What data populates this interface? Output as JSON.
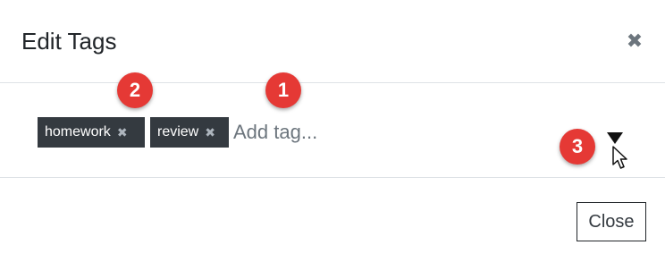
{
  "modal": {
    "title": "Edit Tags",
    "close_icon_glyph": "✖"
  },
  "tags": [
    {
      "label": "homework",
      "remove_glyph": "✖"
    },
    {
      "label": "review",
      "remove_glyph": "✖"
    }
  ],
  "tag_input": {
    "placeholder": "Add tag...",
    "value": ""
  },
  "dropdown": {
    "icon": "caret-down-icon"
  },
  "annotations": [
    {
      "label": "1"
    },
    {
      "label": "2"
    },
    {
      "label": "3"
    }
  ],
  "footer": {
    "close_label": "Close"
  },
  "colors": {
    "tag_background": "#343a40",
    "badge": "#e53935",
    "divider": "#dee2e6"
  }
}
